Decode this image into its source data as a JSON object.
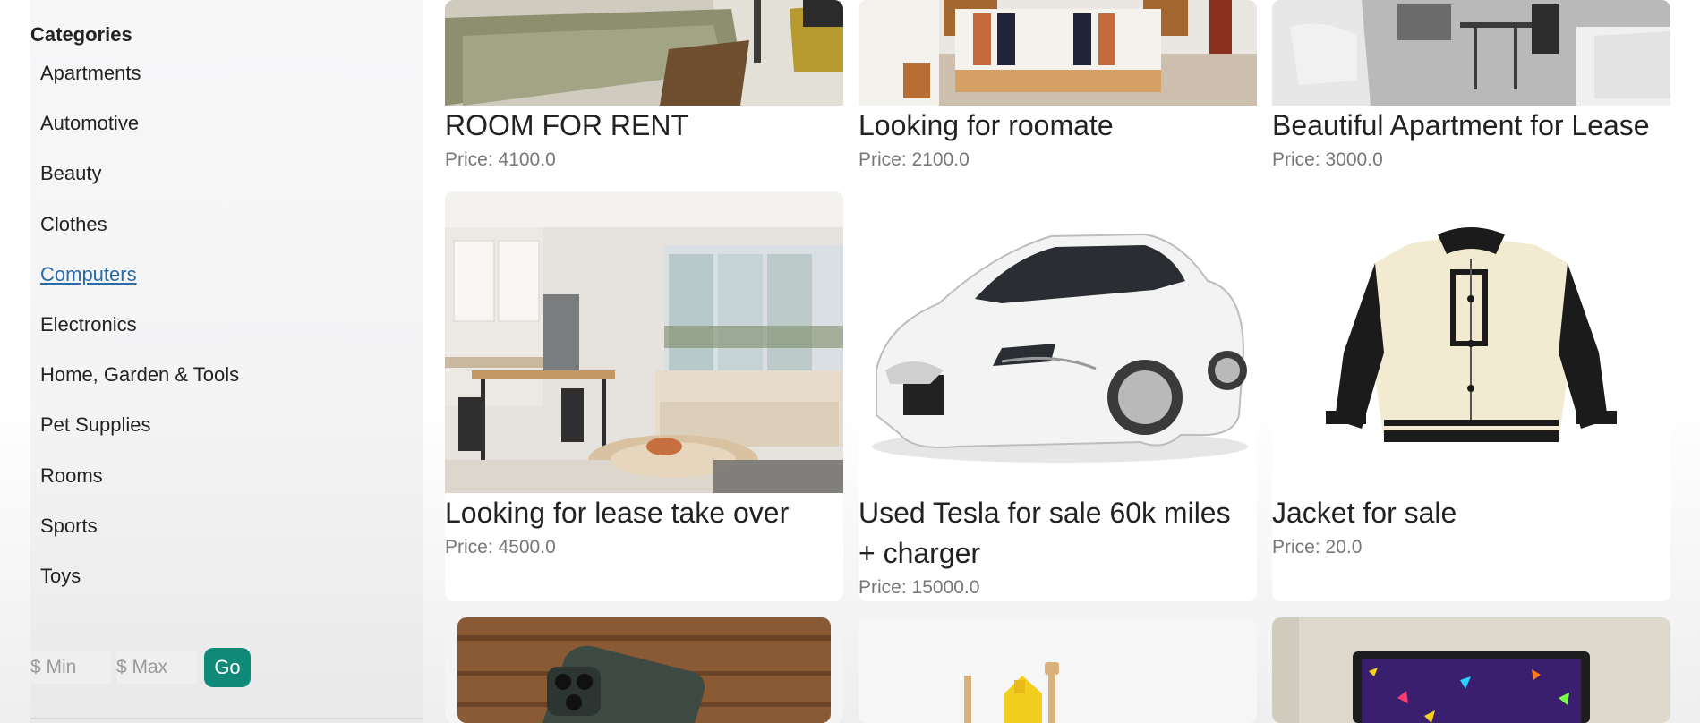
{
  "sidebar": {
    "heading": "Categories",
    "categories": [
      {
        "label": "Apartments"
      },
      {
        "label": "Automotive"
      },
      {
        "label": "Beauty"
      },
      {
        "label": "Clothes"
      },
      {
        "label": "Computers",
        "active": true
      },
      {
        "label": "Electronics"
      },
      {
        "label": "Home, Garden & Tools"
      },
      {
        "label": "Pet Supplies"
      },
      {
        "label": "Rooms"
      },
      {
        "label": "Sports"
      },
      {
        "label": "Toys"
      }
    ],
    "price_filter": {
      "min_placeholder": "$ Min",
      "max_placeholder": "$ Max",
      "go_label": "Go",
      "go_color": "#0f8a78"
    }
  },
  "listings": [
    {
      "title": "ROOM FOR RENT",
      "price": "Price: 4100.0",
      "image": "bedroom-photo"
    },
    {
      "title": "Looking for roomate",
      "price": "Price: 2100.0",
      "image": "bed-photo"
    },
    {
      "title": "Beautiful Apartment for Lease",
      "price": "Price: 3000.0",
      "image": "living-room-photo"
    },
    {
      "title": "Looking for lease take over",
      "price": "Price: 4500.0",
      "image": "apartment-interior-photo"
    },
    {
      "title": "Used Tesla for sale 60k miles + charger",
      "price": "Price: 15000.0",
      "image": "white-tesla-photo"
    },
    {
      "title": "Jacket for sale",
      "price": "Price: 20.0",
      "image": "varsity-jacket-photo"
    },
    {
      "title": "",
      "price": "",
      "image": "smartphone-photo"
    },
    {
      "title": "",
      "price": "",
      "image": "toy-photo"
    },
    {
      "title": "",
      "price": "",
      "image": "laptop-photo"
    }
  ],
  "colors": {
    "active_link": "#2a6aa5",
    "accent": "#0f8a78"
  }
}
